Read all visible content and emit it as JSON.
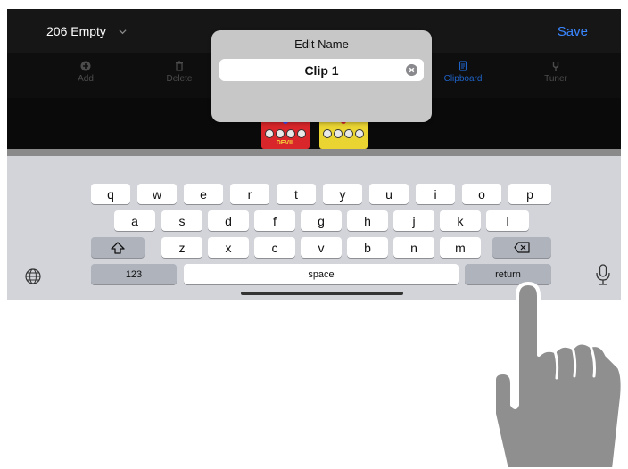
{
  "header": {
    "preset_name": "206 Empty",
    "save_label": "Save"
  },
  "toolbar": {
    "items": [
      {
        "label": "Add",
        "icon": "plus-circle-icon"
      },
      {
        "label": "Delete",
        "icon": "trash-icon"
      },
      {
        "label": "Clipboard",
        "icon": "clipboard-icon",
        "active": true
      },
      {
        "label": "Tuner",
        "icon": "tuning-fork-icon"
      }
    ]
  },
  "pedals": [
    {
      "label": "DEVIL",
      "color": "#d8262b"
    },
    {
      "label": "",
      "color": "#e9d432"
    }
  ],
  "dialog": {
    "title": "Edit Name",
    "value": "Clip 1"
  },
  "keyboard": {
    "row1": [
      "q",
      "w",
      "e",
      "r",
      "t",
      "y",
      "u",
      "i",
      "o",
      "p"
    ],
    "row2": [
      "a",
      "s",
      "d",
      "f",
      "g",
      "h",
      "j",
      "k",
      "l"
    ],
    "row3": [
      "z",
      "x",
      "c",
      "v",
      "b",
      "n",
      "m"
    ],
    "numbers_label": "123",
    "space_label": "space",
    "return_label": "return"
  },
  "colors": {
    "accent": "#3a86ff",
    "keyboard_bg": "#d2d4da",
    "app_bg": "#0b0b0b"
  }
}
